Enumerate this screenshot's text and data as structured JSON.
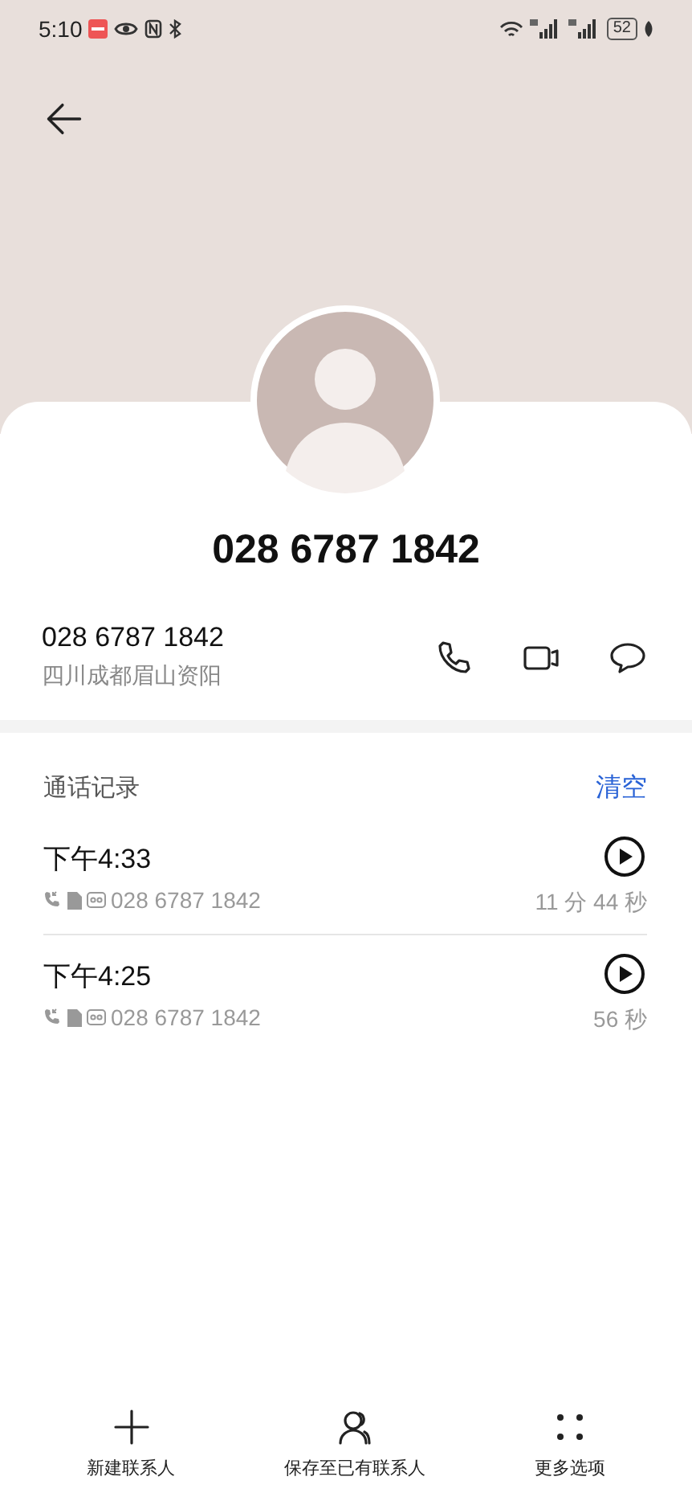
{
  "status_bar": {
    "time": "5:10",
    "battery": "52"
  },
  "contact": {
    "title": "028 6787 1842",
    "number": "028 6787 1842",
    "location": "四川成都眉山资阳"
  },
  "call_log": {
    "title": "通话记录",
    "clear": "清空",
    "calls": [
      {
        "time": "下午4:33",
        "number": "028 6787 1842",
        "duration": "11 分 44 秒"
      },
      {
        "time": "下午4:25",
        "number": "028 6787 1842",
        "duration": "56 秒"
      }
    ]
  },
  "bottom_bar": [
    {
      "kind": "add",
      "label": "新建联系人"
    },
    {
      "kind": "contacts",
      "label": "保存至已有联系人"
    },
    {
      "kind": "more",
      "label": "更多选项"
    }
  ]
}
